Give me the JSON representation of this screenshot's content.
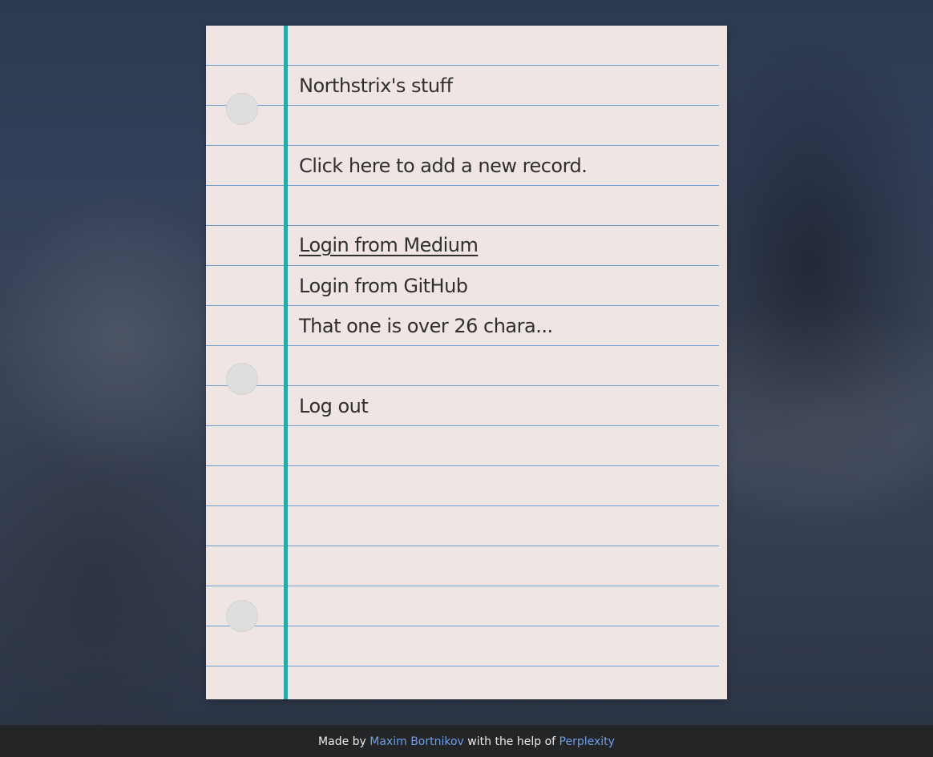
{
  "notebook": {
    "title": "Northstrix's stuff",
    "add_record": "Click here to add a new record.",
    "records": [
      "Login from Medium",
      "Login from GitHub",
      "That one is over 26 chara..."
    ],
    "logout": "Log out"
  },
  "footer": {
    "made_by": "Made by",
    "author": "Maxim Bortnikov",
    "with_help": "with the help of",
    "helper": "Perplexity"
  },
  "colors": {
    "paper": "#efe6e4",
    "rule_line": "#6a9ccf",
    "margin_line": "#2ba9a7",
    "text": "#2f2f2f",
    "footer_bg": "#242527",
    "footer_link": "#6f9fe8"
  }
}
